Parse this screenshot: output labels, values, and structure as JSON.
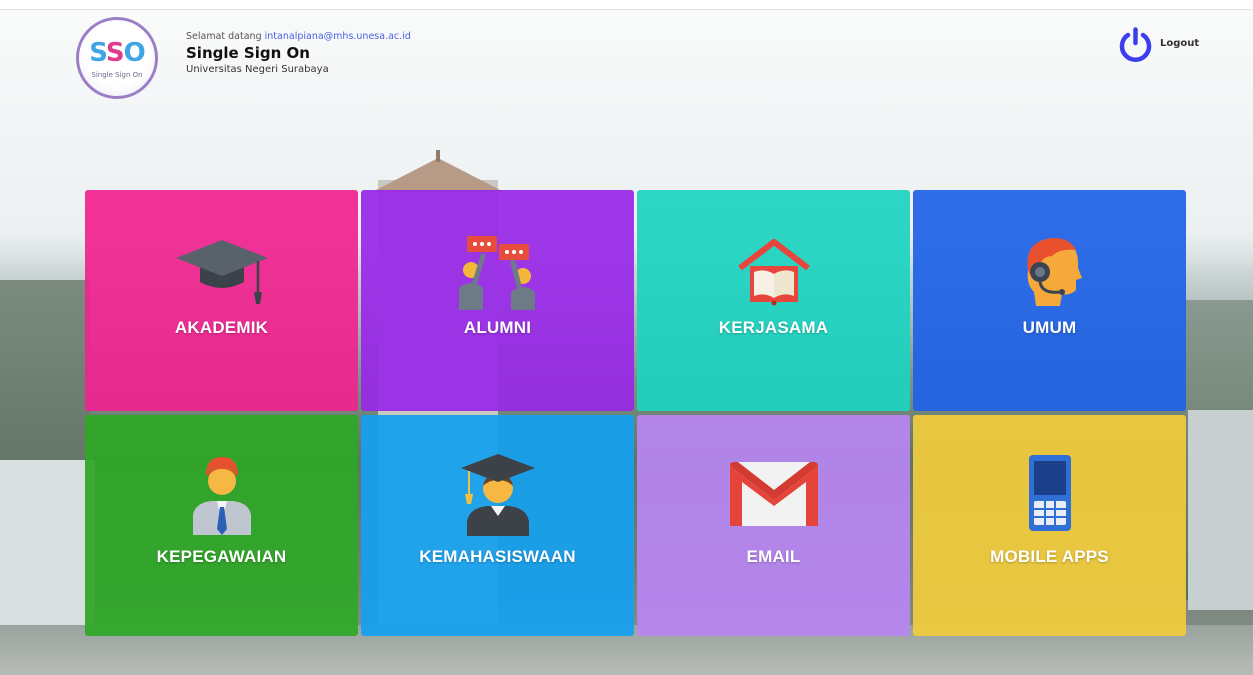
{
  "header": {
    "logo_text": "SSO",
    "logo_subtext": "Single Sign On",
    "welcome_prefix": "Selamat datang ",
    "user_email": "intanalpiana@mhs.unesa.ac.id",
    "app_title": "Single Sign On",
    "university": "Universitas Negeri Surabaya",
    "logout_label": "Logout"
  },
  "tiles": [
    {
      "label": "AKADEMIK",
      "icon": "graduation-cap-icon",
      "color": "#f0248f"
    },
    {
      "label": "ALUMNI",
      "icon": "alumni-chat-icon",
      "color": "#9829e6"
    },
    {
      "label": "KERJASAMA",
      "icon": "open-book-house-icon",
      "color": "#1dd3c0"
    },
    {
      "label": "UMUM",
      "icon": "headset-support-icon",
      "color": "#1f62e6"
    },
    {
      "label": "KEPEGAWAIAN",
      "icon": "employee-icon",
      "color": "#2ea727"
    },
    {
      "label": "KEMAHASISWAAN",
      "icon": "student-graduate-icon",
      "color": "#14a0ef"
    },
    {
      "label": "EMAIL",
      "icon": "gmail-icon",
      "color": "#b885f2"
    },
    {
      "label": "MOBILE APPS",
      "icon": "mobile-phone-icon",
      "color": "#f1cb3c"
    }
  ],
  "colors": {
    "accent": "#4a63e0",
    "logout_icon": "#3d3df0"
  }
}
